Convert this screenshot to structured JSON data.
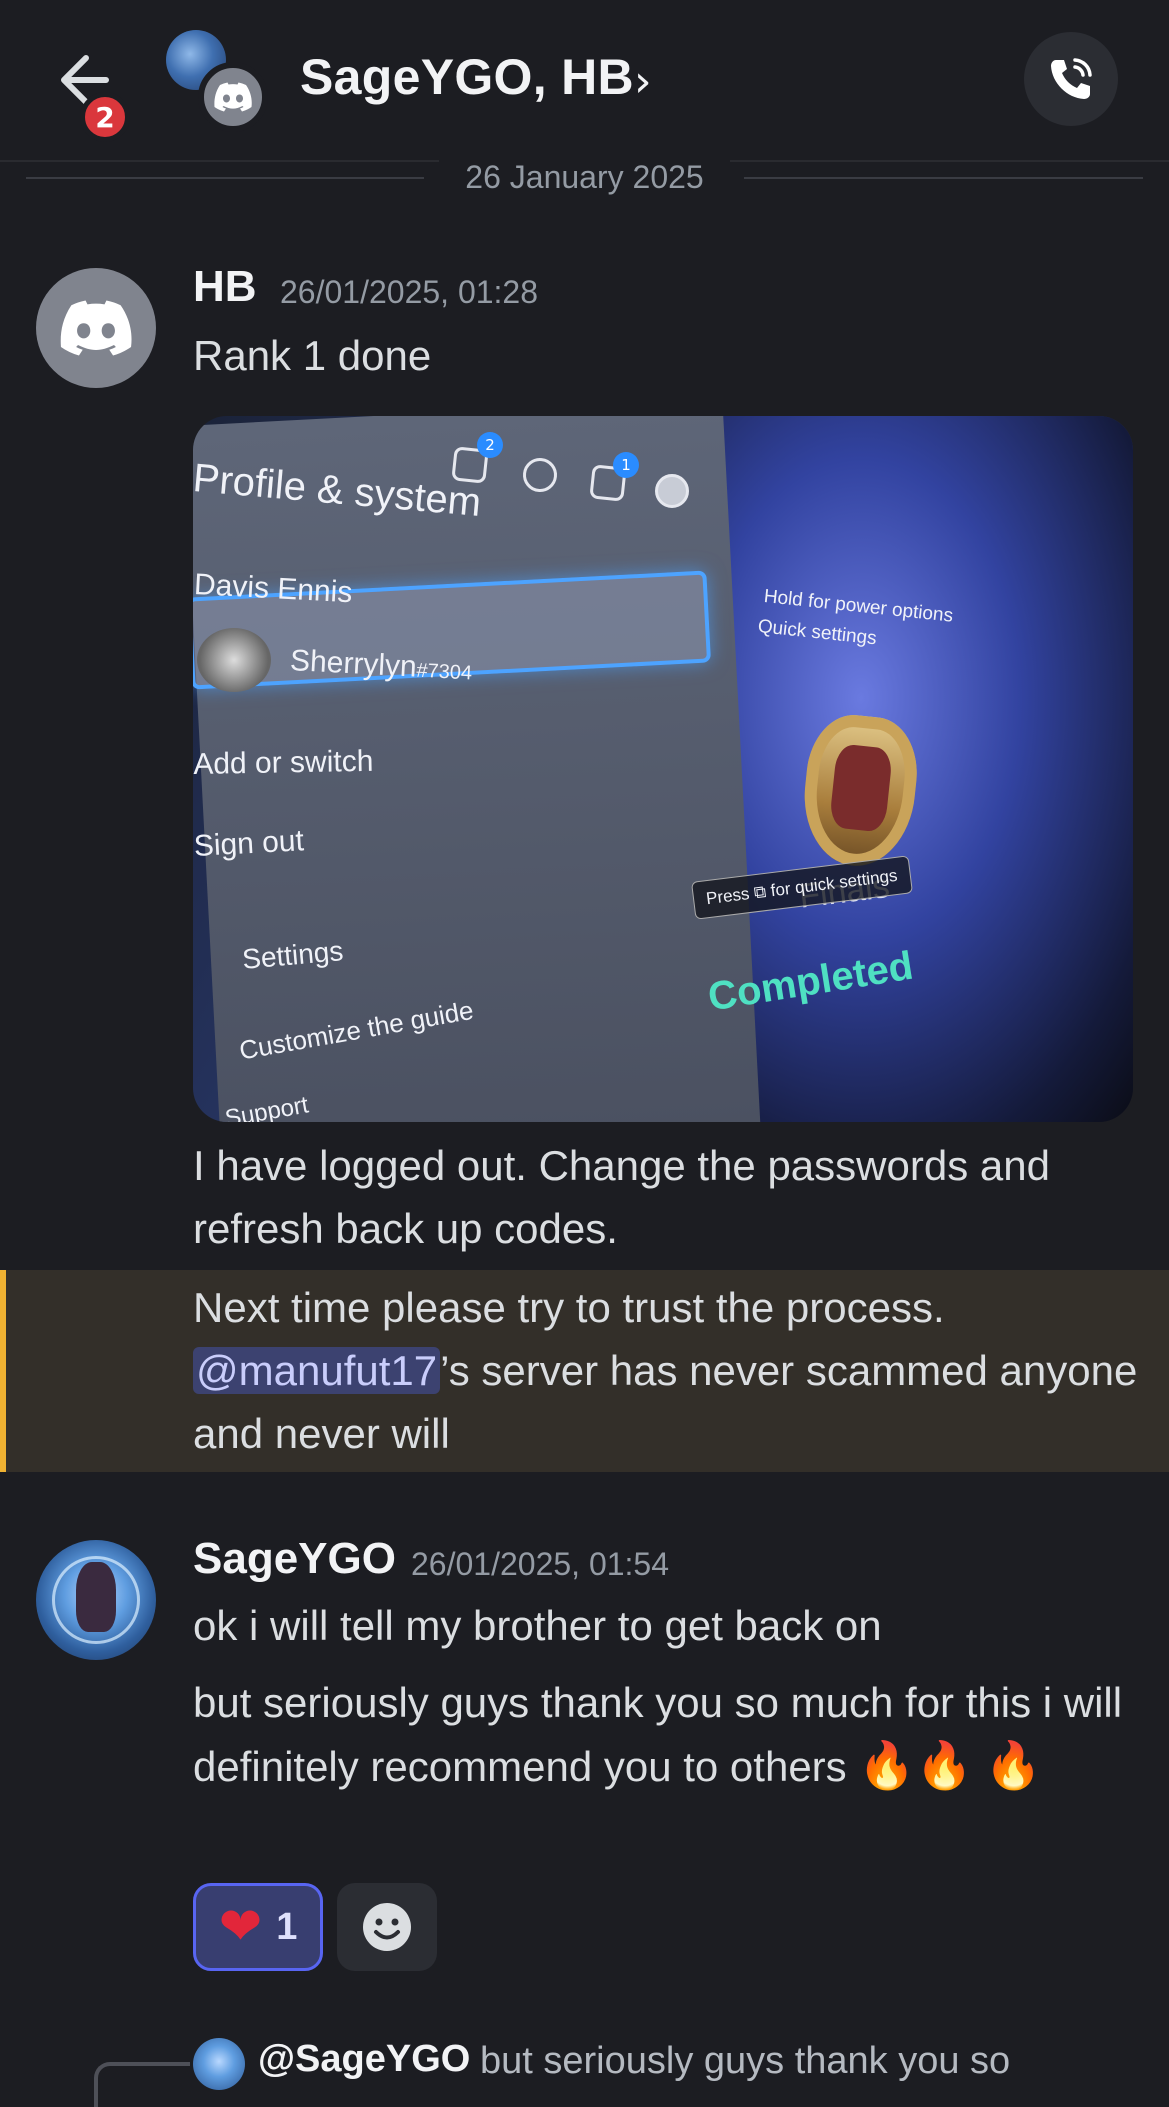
{
  "header": {
    "back_badge_count": "2",
    "title": "SageYGO, HB",
    "chevron": "›",
    "icons": {
      "back": "arrow-left-icon",
      "call": "phone-call-icon",
      "group": "discord-logo-icon"
    }
  },
  "date_divider": "26 January 2025",
  "messages": [
    {
      "author": "HB",
      "timestamp": "26/01/2025, 01:28",
      "lines": [
        "Rank 1 done",
        "I have logged out. Change the passwords and refresh back up codes.",
        "Next time please try to trust the process."
      ],
      "mention": "@manufut17",
      "mention_suffix": "’s server has never scammed anyone and never will",
      "attachment": {
        "profile_title": "Profile & system",
        "account_name": "Davis Ennis",
        "gamertag": "Sherrylyn",
        "gamertag_suffix": "#7304",
        "menu_add": "Add or switch",
        "menu_signout": "Sign out",
        "menu_settings": "Settings",
        "menu_customize": "Customize the guide",
        "menu_support": "Support",
        "hold_power": "Hold for power options",
        "quick_settings": "Quick settings",
        "press_quick": "Press ⧉ for quick settings",
        "finals": "Finals",
        "completed": "Completed",
        "badge_messages": "2",
        "badge_uploads": "1"
      }
    },
    {
      "author": "SageYGO",
      "timestamp": "26/01/2025, 01:54",
      "lines": [
        "ok i will tell my brother to get back on",
        "but seriously guys thank you so much for this i will definitely recommend you to others"
      ],
      "fire_emoji": "🔥",
      "reactions": [
        {
          "emoji": "❤",
          "count": "1"
        }
      ]
    }
  ],
  "reply_preview": {
    "author": "@SageYGO",
    "text": "but seriously guys thank you so"
  },
  "colors": {
    "background": "#1c1d22",
    "mention_highlight": "#332f29",
    "mention_bar": "#f0b232",
    "reaction_active": "#5865f2",
    "badge": "#da373c"
  }
}
